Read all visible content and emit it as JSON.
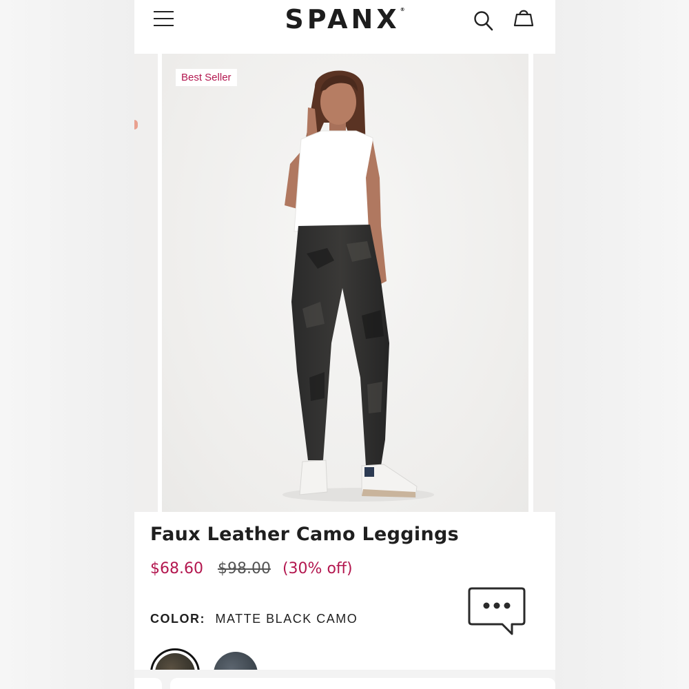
{
  "header": {
    "brand": "SPANX",
    "brand_mark": "®",
    "menu_icon": "hamburger-menu-icon",
    "search_icon": "search-icon",
    "bag_icon": "shopping-bag-icon"
  },
  "gallery": {
    "badge": "Best Seller"
  },
  "product": {
    "title": "Faux Leather Camo Leggings",
    "sale_price": "$68.60",
    "original_price": "$98.00",
    "discount": "(30% off)",
    "color_label": "COLOR:",
    "color_value": "MATTE BLACK CAMO",
    "swatches": [
      "matte-black-camo",
      "navy-camo"
    ]
  },
  "chat": {
    "icon": "chat-bubble-icon"
  },
  "colors": {
    "accent": "#b3174f",
    "text": "#1f1f1f"
  }
}
